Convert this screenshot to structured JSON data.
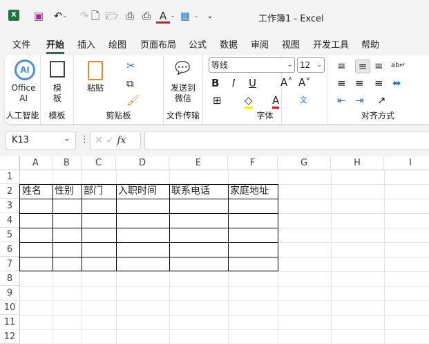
{
  "titlebar": {
    "title": "工作簿1  -  Excel"
  },
  "menu": [
    "文件",
    "开始",
    "插入",
    "绘图",
    "页面布局",
    "公式",
    "数据",
    "审阅",
    "视图",
    "开发工具",
    "帮助"
  ],
  "ribbon": {
    "ai": {
      "button": "Office AI",
      "group": "人工智能"
    },
    "template": {
      "button": "模板",
      "group": "模板"
    },
    "clipboard": {
      "paste": "粘贴",
      "group": "剪贴板"
    },
    "transfer": {
      "button": "发送到微信",
      "group": "文件传输"
    },
    "font": {
      "name": "等线",
      "size": "12",
      "bold": "B",
      "italic": "I",
      "underline": "U",
      "group": "字体",
      "font_color": "#e81123",
      "highlight_color": "#ffee00"
    },
    "align": {
      "group": "对齐方式"
    }
  },
  "formula_bar": {
    "name_box": "K13",
    "fx": "fx",
    "value": ""
  },
  "sheet": {
    "columns": [
      "A",
      "B",
      "C",
      "D",
      "E",
      "F",
      "G",
      "H",
      "I"
    ],
    "rows": [
      "1",
      "2",
      "3",
      "4",
      "5",
      "6",
      "7",
      "8",
      "9",
      "10",
      "11",
      "12"
    ],
    "headers": [
      "姓名",
      "性别",
      "部门",
      "入职时间",
      "联系电话",
      "家庭地址"
    ]
  }
}
